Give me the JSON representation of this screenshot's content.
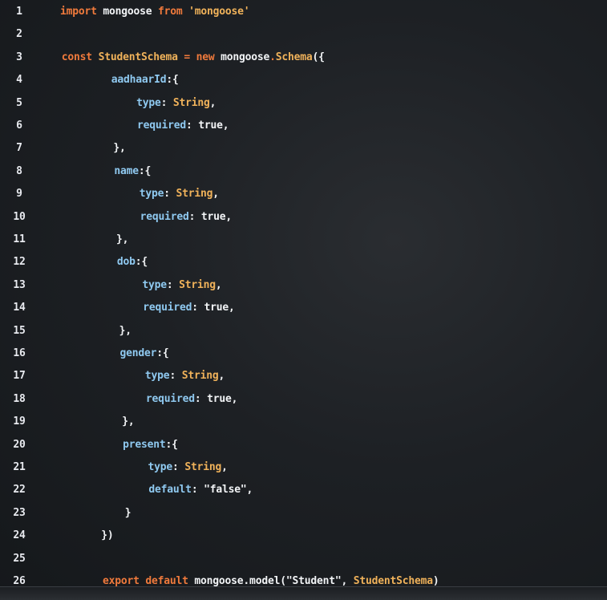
{
  "editor": {
    "language": "javascript",
    "colors": {
      "background": "#1d2024",
      "line_number": "#e8eaef",
      "keyword": "#f07a3c",
      "type": "#f0b25a",
      "property": "#8fc9f0",
      "plain": "#f2f4f6"
    },
    "lines": [
      {
        "n": "1",
        "tokens": [
          [
            "kw",
            "import "
          ],
          [
            "plain",
            "mongoose "
          ],
          [
            "kw",
            "from "
          ],
          [
            "ty",
            "'mongoose'"
          ]
        ]
      },
      {
        "n": "2",
        "tokens": []
      },
      {
        "n": "3",
        "tokens": [
          [
            "kw",
            "const "
          ],
          [
            "ty",
            "StudentSchema "
          ],
          [
            "kw",
            "= new "
          ],
          [
            "plain",
            "mongoose"
          ],
          [
            "kw",
            "."
          ],
          [
            "ty",
            "Schema"
          ],
          [
            "plain",
            "({"
          ]
        ]
      },
      {
        "n": "4",
        "tokens": [
          [
            "plain",
            "        "
          ],
          [
            "prop",
            "aadhaarId"
          ],
          [
            "plain",
            ":{"
          ]
        ]
      },
      {
        "n": "5",
        "tokens": [
          [
            "plain",
            "            "
          ],
          [
            "prop",
            "type"
          ],
          [
            "plain",
            ": "
          ],
          [
            "ty",
            "String"
          ],
          [
            "plain",
            ","
          ]
        ]
      },
      {
        "n": "6",
        "tokens": [
          [
            "plain",
            "            "
          ],
          [
            "prop",
            "required"
          ],
          [
            "plain",
            ": true,"
          ]
        ]
      },
      {
        "n": "7",
        "tokens": [
          [
            "plain",
            "        },"
          ]
        ]
      },
      {
        "n": "8",
        "tokens": [
          [
            "plain",
            "        "
          ],
          [
            "prop",
            "name"
          ],
          [
            "plain",
            ":{"
          ]
        ]
      },
      {
        "n": "9",
        "tokens": [
          [
            "plain",
            "            "
          ],
          [
            "prop",
            "type"
          ],
          [
            "plain",
            ": "
          ],
          [
            "ty",
            "String"
          ],
          [
            "plain",
            ","
          ]
        ]
      },
      {
        "n": "10",
        "tokens": [
          [
            "plain",
            "            "
          ],
          [
            "prop",
            "required"
          ],
          [
            "plain",
            ": true,"
          ]
        ]
      },
      {
        "n": "11",
        "tokens": [
          [
            "plain",
            "        },"
          ]
        ]
      },
      {
        "n": "12",
        "tokens": [
          [
            "plain",
            "        "
          ],
          [
            "prop",
            "dob"
          ],
          [
            "plain",
            ":{"
          ]
        ]
      },
      {
        "n": "13",
        "tokens": [
          [
            "plain",
            "            "
          ],
          [
            "prop",
            "type"
          ],
          [
            "plain",
            ": "
          ],
          [
            "ty",
            "String"
          ],
          [
            "plain",
            ","
          ]
        ]
      },
      {
        "n": "14",
        "tokens": [
          [
            "plain",
            "            "
          ],
          [
            "prop",
            "required"
          ],
          [
            "plain",
            ": true,"
          ]
        ]
      },
      {
        "n": "15",
        "tokens": [
          [
            "plain",
            "        },"
          ]
        ]
      },
      {
        "n": "16",
        "tokens": [
          [
            "plain",
            "        "
          ],
          [
            "prop",
            "gender"
          ],
          [
            "plain",
            ":{"
          ]
        ]
      },
      {
        "n": "17",
        "tokens": [
          [
            "plain",
            "            "
          ],
          [
            "prop",
            "type"
          ],
          [
            "plain",
            ": "
          ],
          [
            "ty",
            "String"
          ],
          [
            "plain",
            ","
          ]
        ]
      },
      {
        "n": "18",
        "tokens": [
          [
            "plain",
            "            "
          ],
          [
            "prop",
            "required"
          ],
          [
            "plain",
            ": true,"
          ]
        ]
      },
      {
        "n": "19",
        "tokens": [
          [
            "plain",
            "        },"
          ]
        ]
      },
      {
        "n": "20",
        "tokens": [
          [
            "plain",
            "        "
          ],
          [
            "prop",
            "present"
          ],
          [
            "plain",
            ":{"
          ]
        ]
      },
      {
        "n": "21",
        "tokens": [
          [
            "plain",
            "            "
          ],
          [
            "prop",
            "type"
          ],
          [
            "plain",
            ": "
          ],
          [
            "ty",
            "String"
          ],
          [
            "plain",
            ","
          ]
        ]
      },
      {
        "n": "22",
        "tokens": [
          [
            "plain",
            "            "
          ],
          [
            "prop",
            "default"
          ],
          [
            "plain",
            ": \"false\","
          ]
        ]
      },
      {
        "n": "23",
        "tokens": [
          [
            "plain",
            "        }"
          ]
        ]
      },
      {
        "n": "24",
        "tokens": [
          [
            "plain",
            "    })"
          ]
        ]
      },
      {
        "n": "25",
        "tokens": []
      },
      {
        "n": "26",
        "tokens": [
          [
            "plain",
            "    "
          ],
          [
            "kw",
            "export default "
          ],
          [
            "plain",
            "mongoose.model(\"Student\", "
          ],
          [
            "ty",
            "StudentSchema"
          ],
          [
            "plain",
            ")"
          ]
        ]
      }
    ]
  }
}
